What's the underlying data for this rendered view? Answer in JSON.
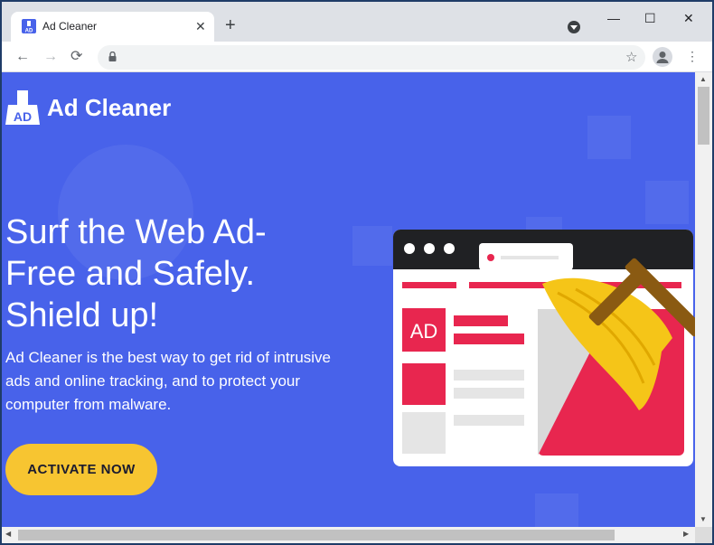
{
  "tab": {
    "title": "Ad Cleaner",
    "close_icon": "close-icon",
    "favicon": "ad-cleaner-favicon"
  },
  "newtab": {
    "symbol": "+"
  },
  "window_controls": {
    "minimize": "—",
    "maximize": "☐",
    "close": "✕"
  },
  "toolbar": {
    "back": "←",
    "forward": "→",
    "reload": "⟳",
    "url": "",
    "star": "☆",
    "menu": "⋮"
  },
  "page": {
    "brand": "Ad Cleaner",
    "headline_lines": [
      "Surf the Web Ad-",
      "Free and Safely.",
      "Shield up!"
    ],
    "description": "Ad Cleaner is the best way to get rid of intrusive ads and online tracking, and to protect your computer from malware.",
    "cta": "ACTIVATE NOW",
    "illustration_ad_label": "AD",
    "logo_text": "AD"
  },
  "colors": {
    "page_bg": "#4862ea",
    "cta": "#f7c531",
    "accent_red": "#e8264f",
    "broom_yellow": "#f5c518"
  }
}
